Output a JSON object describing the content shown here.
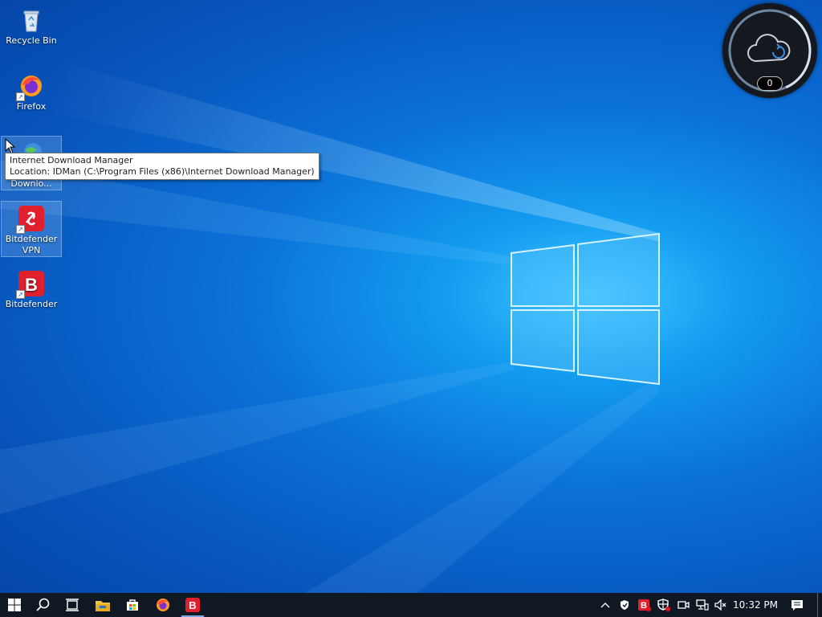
{
  "desktop": {
    "icons": [
      {
        "label": "Recycle Bin"
      },
      {
        "label": "Firefox"
      },
      {
        "label": "Internet Download Manager",
        "label_truncated": "Downlo..."
      },
      {
        "label": "Bitdefender VPN"
      },
      {
        "label": "Bitdefender"
      }
    ],
    "tooltip": {
      "title": "Internet Download Manager",
      "location": "Location: IDMan (C:\\Program Files (x86)\\Internet Download Manager)"
    }
  },
  "widget": {
    "counter": "0",
    "icon": "cloud-sync-icon"
  },
  "taskbar": {
    "buttons": [
      "start-icon",
      "search-icon",
      "task-view-icon",
      "file-explorer-icon",
      "store-icon",
      "firefox-icon",
      "bitdefender-icon"
    ],
    "tray_icons": [
      "chevron-up-icon",
      "vpn-shield-icon",
      "bitdefender-tray-icon",
      "defender-icon",
      "meet-now-icon",
      "network-icon",
      "volume-muted-icon"
    ],
    "clock": "10:32 PM",
    "notification_icon": "action-center-icon"
  },
  "colors": {
    "accent": "#1c8ff0",
    "bitdefender_red": "#e0202c",
    "taskbar": "#101823"
  }
}
